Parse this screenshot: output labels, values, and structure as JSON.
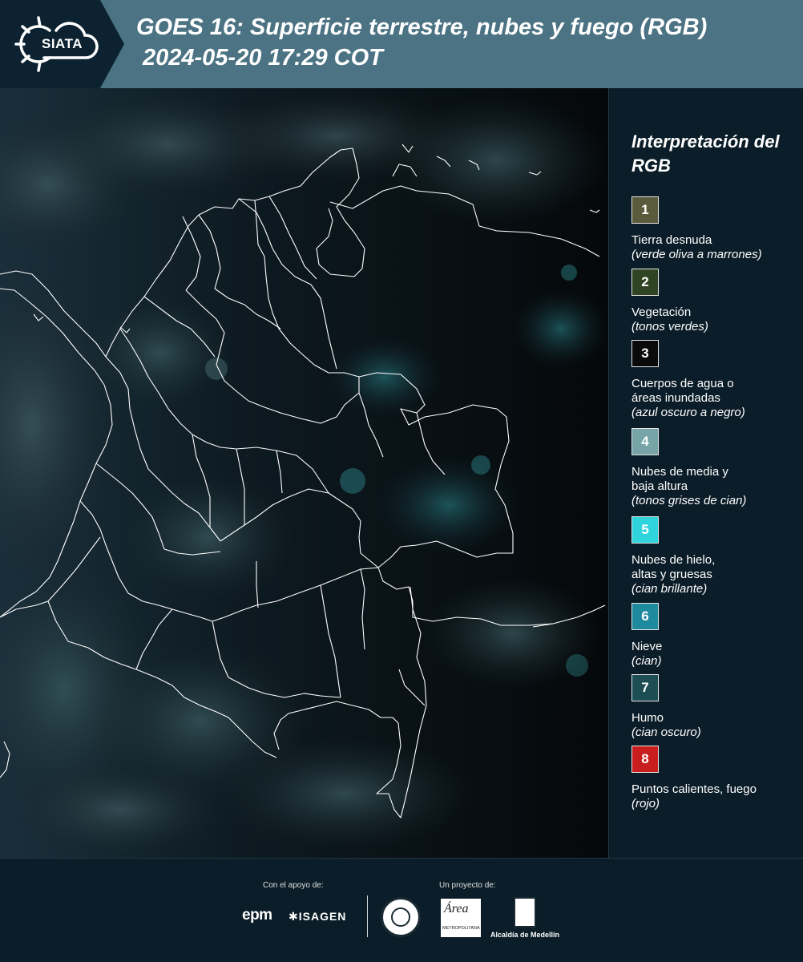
{
  "header": {
    "logo_text": "SIATA",
    "title": "GOES 16: Superficie terrestre, nubes y fuego (RGB)",
    "subtitle": "2024-05-20 17:29 COT"
  },
  "legend": {
    "title": "Interpretación del RGB",
    "items": [
      {
        "num": "1",
        "label": "Tierra desnuda",
        "desc": "(verde oliva a marrones)",
        "color": "#5a5a3c"
      },
      {
        "num": "2",
        "label": "Vegetación",
        "desc": "(tonos verdes)",
        "color": "#2e4423"
      },
      {
        "num": "3",
        "label": "Cuerpos de agua o áreas inundadas",
        "desc": "(azul oscuro a negro)",
        "color": "#0a0a0a"
      },
      {
        "num": "4",
        "label": "Nubes de media y baja altura",
        "desc": "(tonos grises de cian)",
        "color": "#77a5a7"
      },
      {
        "num": "5",
        "label": "Nubes de hielo, altas y gruesas",
        "desc": "(cian brillante)",
        "color": "#2fd4dd"
      },
      {
        "num": "6",
        "label": "Nieve",
        "desc": "(cian)",
        "color": "#1e8a9d"
      },
      {
        "num": "7",
        "label": "Humo",
        "desc": "(cian oscuro)",
        "color": "#1c4e53"
      },
      {
        "num": "8",
        "label": "Puntos calientes, fuego",
        "desc": "(rojo)",
        "color": "#c81e1e"
      }
    ]
  },
  "footer": {
    "support_label": "Con el apoyo de:",
    "project_label": "Un proyecto de:",
    "epm": "epm",
    "isagen": "ISAGEN",
    "area_logo": "Área",
    "area_sub": "METROPOLITANA",
    "alcaldia": "Alcaldía de Medellín"
  },
  "icons": {
    "logo": "siata-sun-cloud-icon",
    "seal": "university-seal-icon",
    "alcaldia": "medellin-shield-icon"
  }
}
